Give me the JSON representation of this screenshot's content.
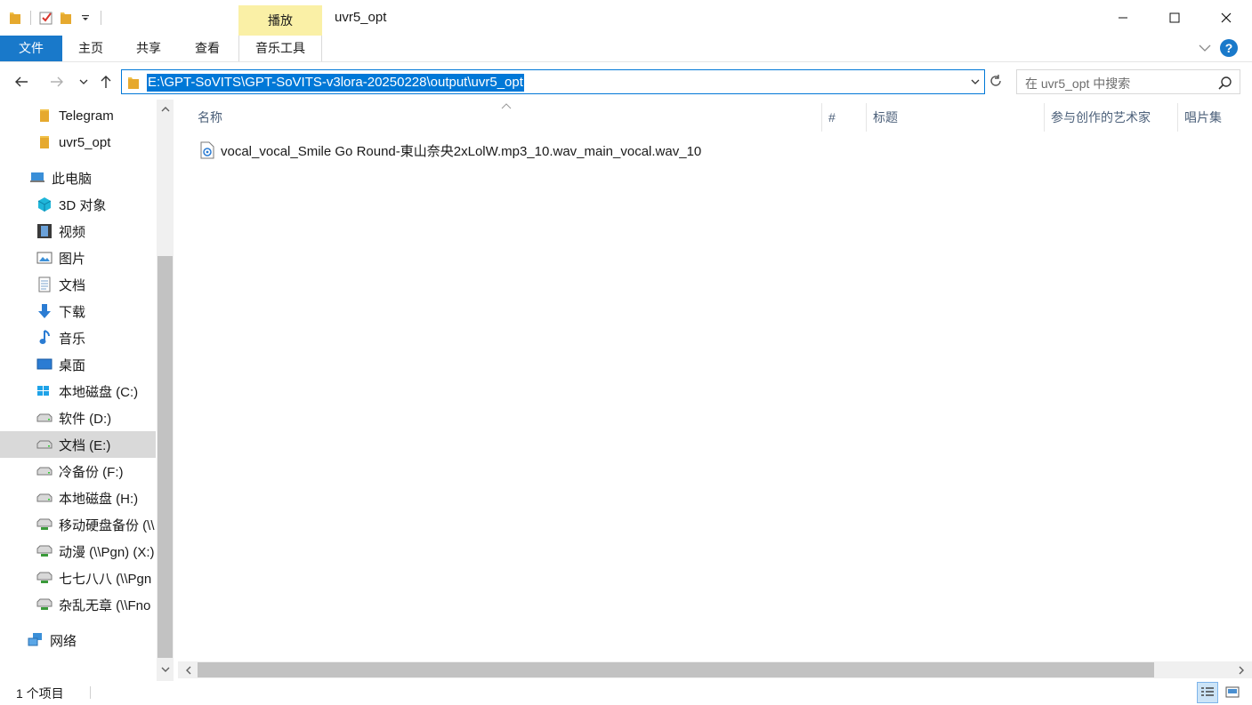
{
  "window": {
    "title": "uvr5_opt",
    "context_tab_group": "播放",
    "controls": [
      "minimize",
      "maximize",
      "close"
    ]
  },
  "ribbon": {
    "tabs": [
      {
        "label": "文件",
        "active": true
      },
      {
        "label": "主页"
      },
      {
        "label": "共享"
      },
      {
        "label": "查看"
      },
      {
        "label": "音乐工具"
      }
    ],
    "help": "?"
  },
  "address": {
    "path": "E:\\GPT-SoVITS\\GPT-SoVITS-v3lora-20250228\\output\\uvr5_opt",
    "search_placeholder": "在 uvr5_opt 中搜索"
  },
  "nav": {
    "items": [
      {
        "label": "Telegram",
        "icon": "folder-icon"
      },
      {
        "label": "uvr5_opt",
        "icon": "folder-icon"
      },
      {
        "label": "此电脑",
        "icon": "computer-icon"
      },
      {
        "label": "3D 对象",
        "icon": "cube-icon"
      },
      {
        "label": "视频",
        "icon": "film-icon"
      },
      {
        "label": "图片",
        "icon": "picture-icon"
      },
      {
        "label": "文档",
        "icon": "document-icon"
      },
      {
        "label": "下载",
        "icon": "download-icon"
      },
      {
        "label": "音乐",
        "icon": "music-icon"
      },
      {
        "label": "桌面",
        "icon": "desktop-icon"
      },
      {
        "label": "本地磁盘 (C:)",
        "icon": "windows-drive-icon"
      },
      {
        "label": "软件 (D:)",
        "icon": "drive-icon"
      },
      {
        "label": "文档 (E:)",
        "icon": "drive-icon",
        "selected": true
      },
      {
        "label": "冷备份 (F:)",
        "icon": "drive-icon"
      },
      {
        "label": "本地磁盘 (H:)",
        "icon": "drive-icon"
      },
      {
        "label": "移动硬盘备份 (\\\\",
        "icon": "network-drive-icon"
      },
      {
        "label": "动漫 (\\\\Pgn) (X:)",
        "icon": "network-drive-icon"
      },
      {
        "label": "七七八八 (\\\\Pgn",
        "icon": "network-drive-icon"
      },
      {
        "label": "杂乱无章 (\\\\Fno",
        "icon": "network-drive-icon"
      },
      {
        "label": "网络",
        "icon": "network-icon"
      }
    ]
  },
  "columns": {
    "name": "名称",
    "number": "#",
    "title": "标题",
    "artist": "参与创作的艺术家",
    "album": "唱片集"
  },
  "files": [
    {
      "name": "vocal_vocal_Smile Go Round-東山奈央2xLolW.mp3_10.wav_main_vocal.wav_10",
      "icon": "audio-file-icon"
    }
  ],
  "status": {
    "count": "1 个项目"
  },
  "colors": {
    "accent": "#0078d7",
    "file_tab": "#1979ca",
    "context_tab": "#faf0a6",
    "selection": "#d9d9d9"
  }
}
